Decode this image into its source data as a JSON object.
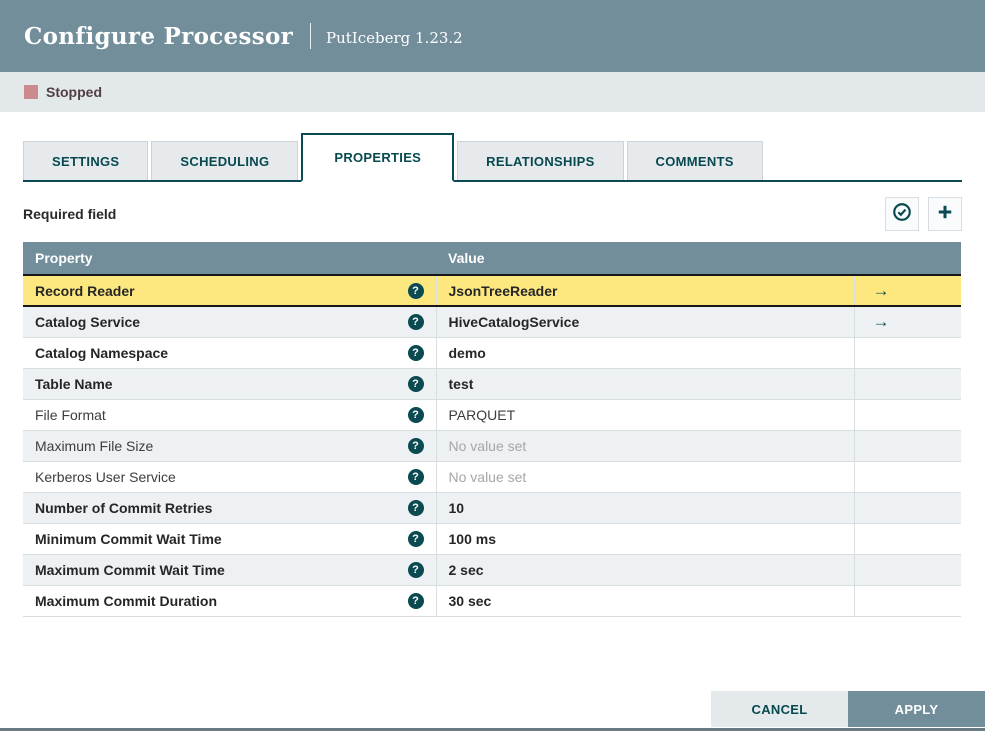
{
  "dialog": {
    "title": "Configure Processor",
    "subtitle": "PutIceberg 1.23.2"
  },
  "status_bar": {
    "state_label": "Stopped",
    "icon": "stopped-square-icon",
    "icon_color": "#cb8a8d"
  },
  "tabs": [
    {
      "label": "SETTINGS",
      "active": false
    },
    {
      "label": "SCHEDULING",
      "active": false
    },
    {
      "label": "PROPERTIES",
      "active": true
    },
    {
      "label": "RELATIONSHIPS",
      "active": false
    },
    {
      "label": "COMMENTS",
      "active": false
    }
  ],
  "properties_panel": {
    "required_field_label": "Required field",
    "toolbar": {
      "verify_button_icon": "check-circle-icon",
      "add_button_icon": "plus-icon"
    },
    "table": {
      "columns": [
        "Property",
        "Value"
      ],
      "rows": [
        {
          "property": "Record Reader",
          "value": "JsonTreeReader",
          "required": true,
          "empty": false,
          "selected": true,
          "has_goto": true
        },
        {
          "property": "Catalog Service",
          "value": "HiveCatalogService",
          "required": true,
          "empty": false,
          "selected": false,
          "has_goto": true
        },
        {
          "property": "Catalog Namespace",
          "value": "demo",
          "required": true,
          "empty": false,
          "selected": false,
          "has_goto": false
        },
        {
          "property": "Table Name",
          "value": "test",
          "required": true,
          "empty": false,
          "selected": false,
          "has_goto": false
        },
        {
          "property": "File Format",
          "value": "PARQUET",
          "required": false,
          "empty": false,
          "selected": false,
          "has_goto": false
        },
        {
          "property": "Maximum File Size",
          "value": "No value set",
          "required": false,
          "empty": true,
          "selected": false,
          "has_goto": false
        },
        {
          "property": "Kerberos User Service",
          "value": "No value set",
          "required": false,
          "empty": true,
          "selected": false,
          "has_goto": false
        },
        {
          "property": "Number of Commit Retries",
          "value": "10",
          "required": true,
          "empty": false,
          "selected": false,
          "has_goto": false
        },
        {
          "property": "Minimum Commit Wait Time",
          "value": "100 ms",
          "required": true,
          "empty": false,
          "selected": false,
          "has_goto": false
        },
        {
          "property": "Maximum Commit Wait Time",
          "value": "2 sec",
          "required": true,
          "empty": false,
          "selected": false,
          "has_goto": false
        },
        {
          "property": "Maximum Commit Duration",
          "value": "30 sec",
          "required": true,
          "empty": false,
          "selected": false,
          "has_goto": false
        }
      ]
    }
  },
  "footer": {
    "cancel_label": "CANCEL",
    "apply_label": "APPLY"
  },
  "icons": {
    "help_glyph": "?",
    "goto_glyph": "→"
  },
  "colors": {
    "header_bg": "#728e9b",
    "accent_teal": "#0b4a52",
    "highlight_row": "#fde880",
    "stopped_red": "#cb8a8d",
    "status_bar_bg": "#e3e8ea",
    "table_header_bg": "#728e9b",
    "cancel_bg": "#e4e9ec",
    "apply_bg": "#728e9b"
  }
}
